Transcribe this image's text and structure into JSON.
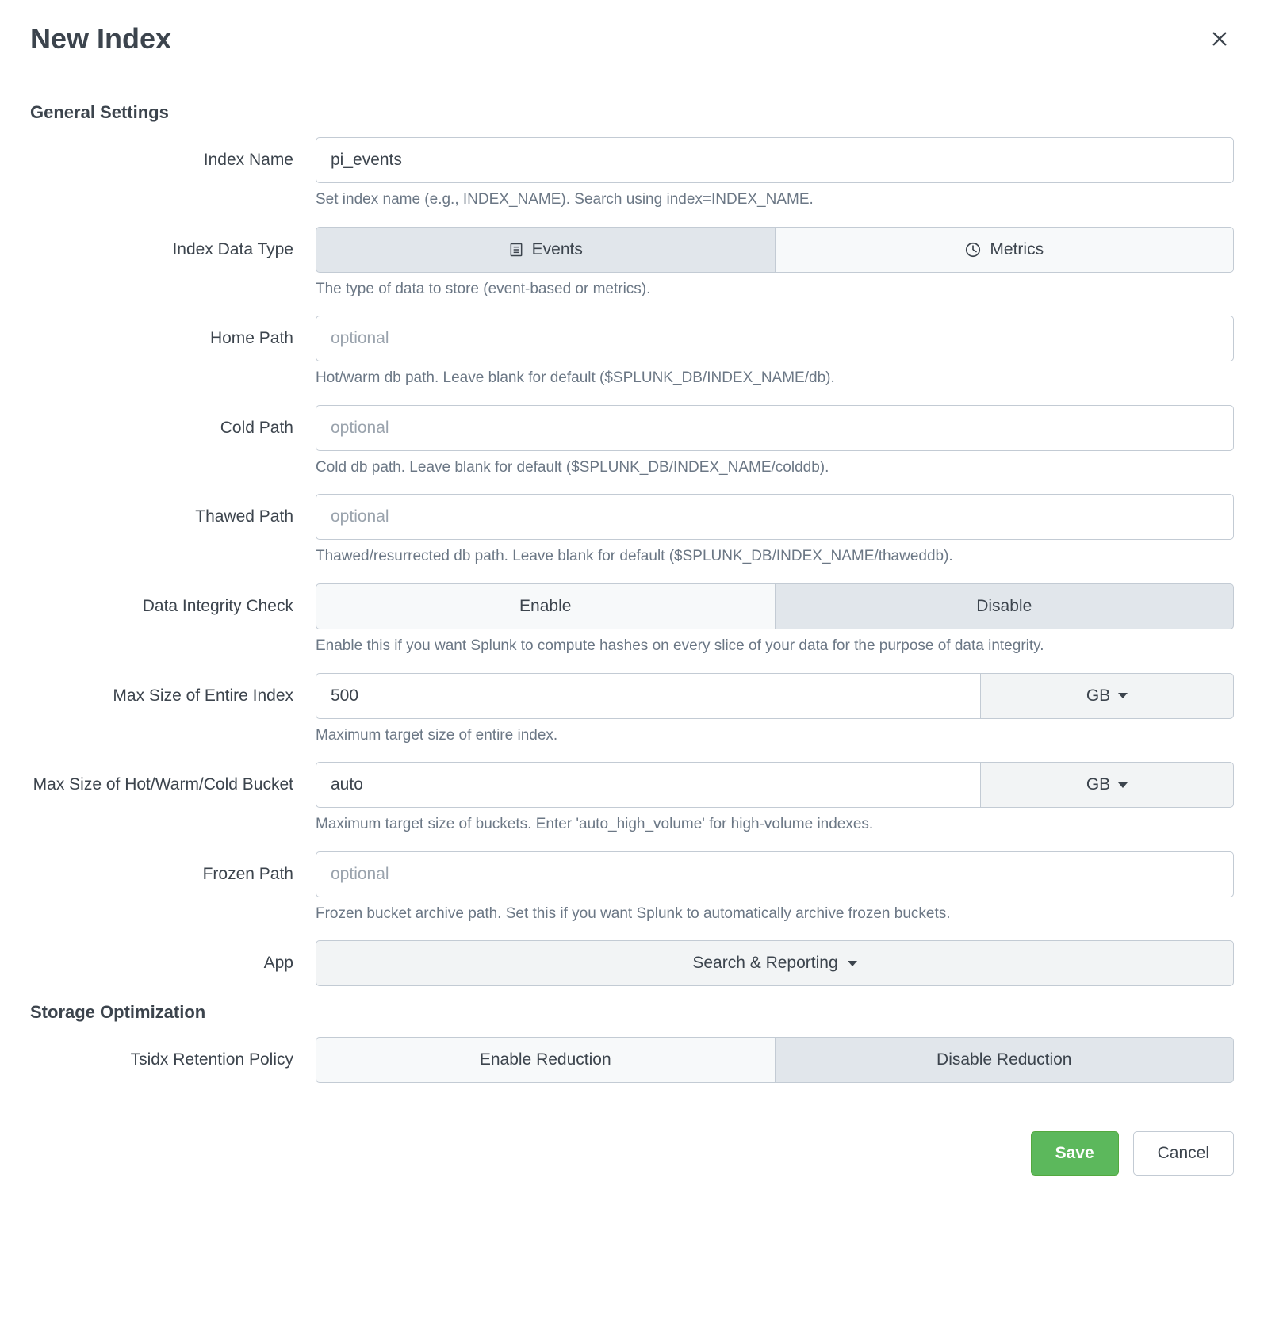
{
  "modal": {
    "title": "New Index"
  },
  "sections": {
    "general": "General Settings",
    "storage": "Storage Optimization"
  },
  "fields": {
    "indexName": {
      "label": "Index Name",
      "value": "pi_events",
      "help": "Set index name (e.g., INDEX_NAME). Search using index=INDEX_NAME."
    },
    "dataType": {
      "label": "Index Data Type",
      "options": {
        "events": "Events",
        "metrics": "Metrics"
      },
      "selected": "events",
      "help": "The type of data to store (event-based or metrics)."
    },
    "homePath": {
      "label": "Home Path",
      "placeholder": "optional",
      "value": "",
      "help": "Hot/warm db path. Leave blank for default ($SPLUNK_DB/INDEX_NAME/db)."
    },
    "coldPath": {
      "label": "Cold Path",
      "placeholder": "optional",
      "value": "",
      "help": "Cold db path. Leave blank for default ($SPLUNK_DB/INDEX_NAME/colddb)."
    },
    "thawedPath": {
      "label": "Thawed Path",
      "placeholder": "optional",
      "value": "",
      "help": "Thawed/resurrected db path. Leave blank for default ($SPLUNK_DB/INDEX_NAME/thaweddb)."
    },
    "integrity": {
      "label": "Data Integrity Check",
      "options": {
        "enable": "Enable",
        "disable": "Disable"
      },
      "selected": "disable",
      "help": "Enable this if you want Splunk to compute hashes on every slice of your data for the purpose of data integrity."
    },
    "maxSizeIndex": {
      "label": "Max Size of Entire Index",
      "value": "500",
      "unit": "GB",
      "help": "Maximum target size of entire index."
    },
    "maxSizeBucket": {
      "label": "Max Size of Hot/Warm/Cold Bucket",
      "value": "auto",
      "unit": "GB",
      "help": "Maximum target size of buckets. Enter 'auto_high_volume' for high-volume indexes."
    },
    "frozenPath": {
      "label": "Frozen Path",
      "placeholder": "optional",
      "value": "",
      "help": "Frozen bucket archive path. Set this if you want Splunk to automatically archive frozen buckets."
    },
    "app": {
      "label": "App",
      "selected": "Search & Reporting"
    },
    "tsidx": {
      "label": "Tsidx Retention Policy",
      "options": {
        "enable": "Enable Reduction",
        "disable": "Disable Reduction"
      },
      "selected": "disable"
    }
  },
  "footer": {
    "save": "Save",
    "cancel": "Cancel"
  }
}
